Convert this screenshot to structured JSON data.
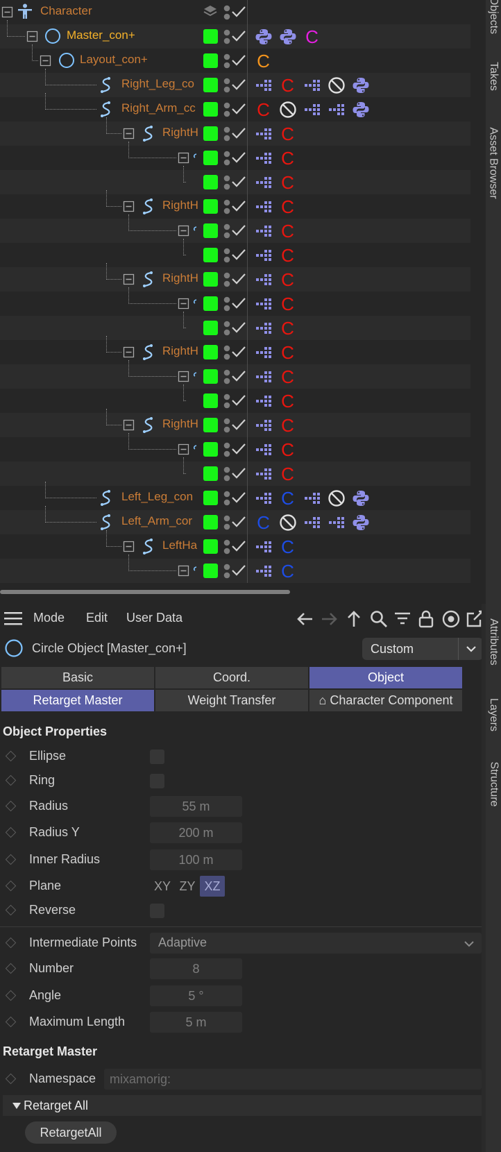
{
  "object_manager": {
    "side_tabs": [
      "Objects",
      "Takes",
      "Asset Browser"
    ],
    "rows": [
      {
        "name": "Character",
        "depth": 0,
        "icon": "character-icon",
        "expander": true,
        "visibility": "layer",
        "tags": []
      },
      {
        "name": "Master_con+",
        "depth": 1,
        "icon": "circle-icon",
        "expander": true,
        "selected": true,
        "tags": [
          "python-tag",
          "python-tag",
          "c-magenta"
        ]
      },
      {
        "name": "Layout_con+",
        "depth": 2,
        "icon": "circle-icon",
        "expander": true,
        "tags": [
          "c-orange"
        ]
      },
      {
        "name": "Right_Leg_co",
        "depth": 3,
        "icon": "spline-icon",
        "tags": [
          "ik-tag",
          "c-red",
          "ik-tag",
          "no-tag",
          "python-tag"
        ]
      },
      {
        "name": "Right_Arm_cc",
        "depth": 3,
        "icon": "spline-icon",
        "tags": [
          "c-red",
          "no-tag",
          "ik-tag",
          "ik-tag",
          "python-tag"
        ]
      },
      {
        "name": "RightH",
        "depth": 4,
        "icon": "spline-icon",
        "expander": true,
        "tags": [
          "ik-tag",
          "c-red"
        ]
      },
      {
        "name": "",
        "depth": 5,
        "icon": "",
        "expander": true,
        "tags": [
          "ik-tag",
          "c-red"
        ]
      },
      {
        "name": "",
        "depth": 6,
        "icon": "",
        "tags": [
          "ik-tag",
          "c-red"
        ]
      },
      {
        "name": "RightH",
        "depth": 4,
        "icon": "spline-icon",
        "expander": true,
        "tags": [
          "ik-tag",
          "c-red"
        ]
      },
      {
        "name": "",
        "depth": 5,
        "icon": "",
        "expander": true,
        "tags": [
          "ik-tag",
          "c-red"
        ]
      },
      {
        "name": "",
        "depth": 6,
        "icon": "",
        "tags": [
          "ik-tag",
          "c-red"
        ]
      },
      {
        "name": "RightH",
        "depth": 4,
        "icon": "spline-icon",
        "expander": true,
        "tags": [
          "ik-tag",
          "c-red"
        ]
      },
      {
        "name": "",
        "depth": 5,
        "icon": "",
        "expander": true,
        "tags": [
          "ik-tag",
          "c-red"
        ]
      },
      {
        "name": "",
        "depth": 6,
        "icon": "",
        "tags": [
          "ik-tag",
          "c-red"
        ]
      },
      {
        "name": "RightH",
        "depth": 4,
        "icon": "spline-icon",
        "expander": true,
        "tags": [
          "ik-tag",
          "c-red"
        ]
      },
      {
        "name": "",
        "depth": 5,
        "icon": "",
        "expander": true,
        "tags": [
          "ik-tag",
          "c-red"
        ]
      },
      {
        "name": "",
        "depth": 6,
        "icon": "",
        "tags": [
          "ik-tag",
          "c-red"
        ]
      },
      {
        "name": "RightH",
        "depth": 4,
        "icon": "spline-icon",
        "expander": true,
        "tags": [
          "ik-tag",
          "c-red"
        ]
      },
      {
        "name": "",
        "depth": 5,
        "icon": "",
        "expander": true,
        "tags": [
          "ik-tag",
          "c-red"
        ]
      },
      {
        "name": "",
        "depth": 6,
        "icon": "",
        "tags": [
          "ik-tag",
          "c-red"
        ]
      },
      {
        "name": "Left_Leg_con",
        "depth": 3,
        "icon": "spline-icon",
        "tags": [
          "ik-tag",
          "c-blue",
          "ik-tag",
          "no-tag",
          "python-tag"
        ]
      },
      {
        "name": "Left_Arm_cor",
        "depth": 3,
        "icon": "spline-icon",
        "tags": [
          "c-blue",
          "no-tag",
          "ik-tag",
          "ik-tag",
          "python-tag"
        ]
      },
      {
        "name": "LeftHa",
        "depth": 4,
        "icon": "spline-icon",
        "expander": true,
        "tags": [
          "ik-tag",
          "c-blue"
        ]
      },
      {
        "name": "",
        "depth": 5,
        "icon": "",
        "expander": true,
        "tags": [
          "ik-tag",
          "c-blue"
        ]
      }
    ],
    "c_tag_letter": "C"
  },
  "attributes": {
    "side_tabs": [
      "Attributes",
      "Layers",
      "Structure"
    ],
    "menu": {
      "mode": "Mode",
      "edit": "Edit",
      "user_data": "User Data"
    },
    "toolbar_icons": [
      "arrow-left-icon",
      "arrow-right-icon",
      "arrow-up-icon",
      "search-icon",
      "filter-icon",
      "lock-icon",
      "target-icon",
      "new-window-icon"
    ],
    "object_title": "Circle Object [Master_con+]",
    "preset": "Custom",
    "tabs_row1": [
      {
        "label": "Basic",
        "active": false
      },
      {
        "label": "Coord.",
        "active": false
      },
      {
        "label": "Object",
        "active": true
      }
    ],
    "tabs_row2": [
      {
        "label": "Retarget Master",
        "active": true
      },
      {
        "label": "Weight Transfer",
        "active": false
      },
      {
        "label": "⌂ Character Component",
        "active": false
      }
    ],
    "object_properties": {
      "title": "Object Properties",
      "ellipse": "Ellipse",
      "ring": "Ring",
      "radius": {
        "label": "Radius",
        "value": "55 m"
      },
      "radius_y": {
        "label": "Radius Y",
        "value": "200 m"
      },
      "inner_radius": {
        "label": "Inner Radius",
        "value": "100 m"
      },
      "plane": {
        "label": "Plane",
        "options": [
          "XY",
          "ZY",
          "XZ"
        ],
        "selected": "XZ"
      },
      "reverse": "Reverse",
      "intermediate_points": {
        "label": "Intermediate Points",
        "value": "Adaptive"
      },
      "number": {
        "label": "Number",
        "value": "8"
      },
      "angle": {
        "label": "Angle",
        "value": "5 °"
      },
      "maximum_length": {
        "label": "Maximum Length",
        "value": "5 m"
      }
    },
    "retarget_master": {
      "title": "Retarget Master",
      "namespace": {
        "label": "Namespace",
        "placeholder": "mixamorig:"
      },
      "group": "Retarget All",
      "button": "RetargetAll"
    }
  },
  "colors": {
    "c_red": "#e8160f",
    "c_blue": "#1d4de6",
    "c_orange": "#f3941d",
    "c_magenta": "#e41fe0",
    "tag_purple": "#8f8fe8",
    "object_name": "#cb7d37",
    "selected_name": "#f5b22a",
    "visibility_green": "#17f517",
    "active_tab": "#5a5ea6"
  }
}
